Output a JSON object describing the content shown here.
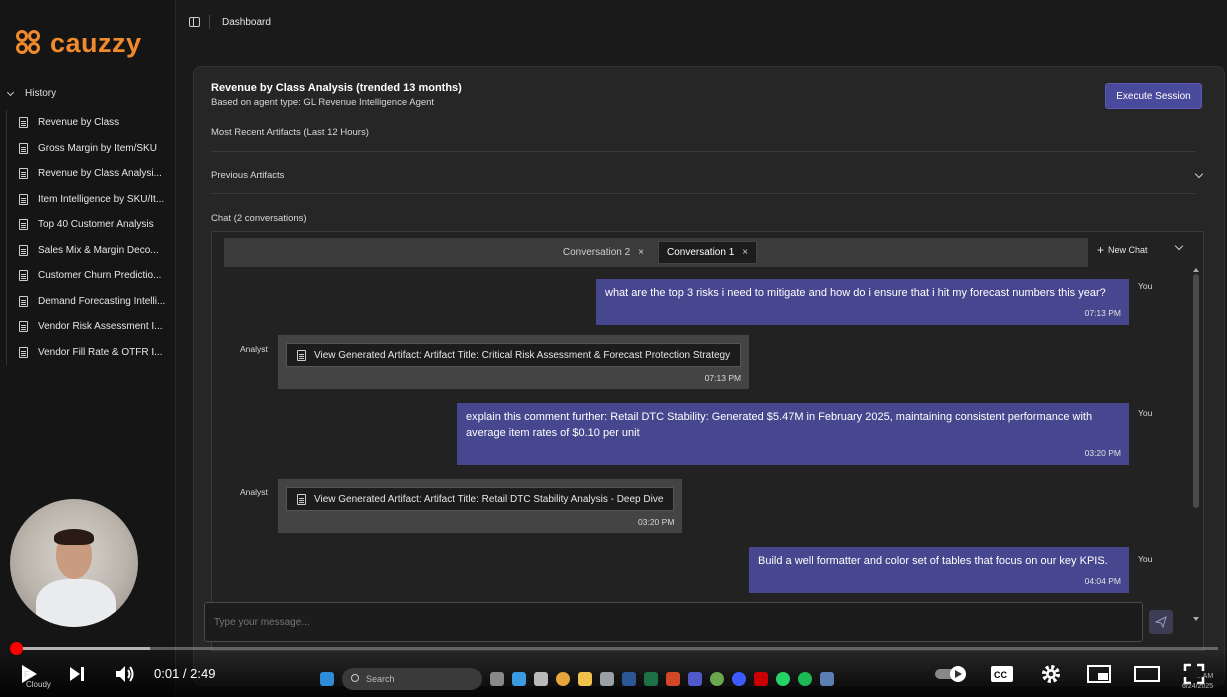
{
  "brand": {
    "name": "cauzzy",
    "color": "#f08a2c"
  },
  "sidebar": {
    "history_label": "History",
    "items": [
      {
        "label": "Revenue by Class"
      },
      {
        "label": "Gross Margin by Item/SKU"
      },
      {
        "label": "Revenue by Class Analysi..."
      },
      {
        "label": "Item Intelligence by SKU/It..."
      },
      {
        "label": "Top 40 Customer Analysis"
      },
      {
        "label": "Sales Mix & Margin Deco..."
      },
      {
        "label": "Customer Churn Predictio..."
      },
      {
        "label": "Demand Forecasting Intelli..."
      },
      {
        "label": "Vendor Risk Assessment I..."
      },
      {
        "label": "Vendor Fill Rate & OTFR I..."
      }
    ]
  },
  "topbar": {
    "breadcrumb": "Dashboard"
  },
  "session": {
    "title": "Revenue by Class Analysis (trended 13 months)",
    "subtitle": "Based on agent type: GL Revenue Intelligence Agent",
    "execute_label": "Execute Session",
    "recent_artifacts_label": "Most Recent Artifacts (Last 12 Hours)",
    "previous_artifacts_label": "Previous Artifacts",
    "chat_label": "Chat (2 conversations)"
  },
  "chat": {
    "tabs": [
      {
        "label": "Conversation 2",
        "close": "×"
      },
      {
        "label": "Conversation 1",
        "close": "×"
      }
    ],
    "new_chat_label": "New Chat",
    "messages": [
      {
        "role": "You",
        "text": "what are the top 3 risks i need to mitigate and how do i ensure that i hit my forecast numbers this year?",
        "time": "07:13 PM"
      },
      {
        "role": "Analyst",
        "text": "View Generated Artifact: Artifact Title: Critical Risk Assessment & Forecast Protection Strategy",
        "time": "07:13 PM"
      },
      {
        "role": "You",
        "text": "explain this comment further: Retail DTC Stability: Generated $5.47M in February 2025, maintaining consistent performance with average item rates of $0.10 per unit",
        "time": "03:20 PM"
      },
      {
        "role": "Analyst",
        "text": "View Generated Artifact: Artifact Title: Retail DTC Stability Analysis - Deep Dive",
        "time": "03:20 PM"
      },
      {
        "role": "You",
        "text": "Build a well formatter and color set of tables that focus on our key KPIS.",
        "time": "04:04 PM"
      }
    ],
    "input_placeholder": "Type your message..."
  },
  "video": {
    "current_time": "0:01",
    "separator": " / ",
    "duration": "2:49",
    "progress_fraction": 0.006
  },
  "taskbar": {
    "search_placeholder": "Search",
    "weather_temp": "F",
    "weather_text": "Cloudy",
    "tray_time": "...AM",
    "tray_date": "6/24/2025"
  },
  "colors": {
    "accent": "#47478f",
    "button": "#4a4a9c",
    "progress": "#ff0000"
  }
}
